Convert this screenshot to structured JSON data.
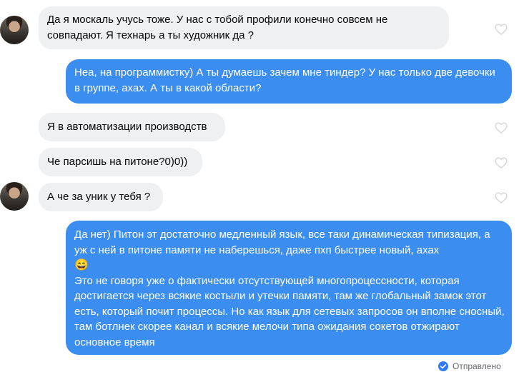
{
  "messages": [
    {
      "id": "m1",
      "sender": "contact",
      "text": "Да я москаль учусь тоже. У нас с тобой профили конечно совсем не совпадают. Я технарь а ты художник да ?"
    },
    {
      "id": "m2",
      "sender": "me",
      "text": "Неа, на программистку) А ты думаешь зачем мне тиндер? У нас только две девочки в группе, ахах. А ты в какой области?"
    },
    {
      "id": "m3",
      "sender": "contact",
      "text": "Я в автоматизации производств"
    },
    {
      "id": "m4",
      "sender": "contact",
      "text": "Че парсишь на питоне?0)0))"
    },
    {
      "id": "m5",
      "sender": "contact",
      "text": "А че за уник у тебя ?"
    },
    {
      "id": "m6",
      "sender": "me",
      "text_part1": "Да нет) Питон эт достаточно медленный язык, все таки динамическая типизация, а уж с ней в питоне памяти не наберешься, даже пхп быстрее новый, ахах",
      "emoji": "😄",
      "text_part2": " Это не говоря уже о фактически отсутствующей многопроцессности, которая достигается через всякие костыли и утечки памяти, там же глобальный замок этот есть, который почит процессы. Но как язык для сетевых запросов он вполне сносный, там ботлнек скорее канал и всякие мелочи типа ожидания сокетов отжирают основное время"
    }
  ],
  "status": {
    "label": "Отправлено"
  },
  "colors": {
    "outgoing": "#3b8ef0",
    "incoming": "#eff0f2",
    "check": "#2f7cf6"
  },
  "icons": {
    "like": "heart-outline-icon",
    "sent": "check-circle-icon"
  }
}
